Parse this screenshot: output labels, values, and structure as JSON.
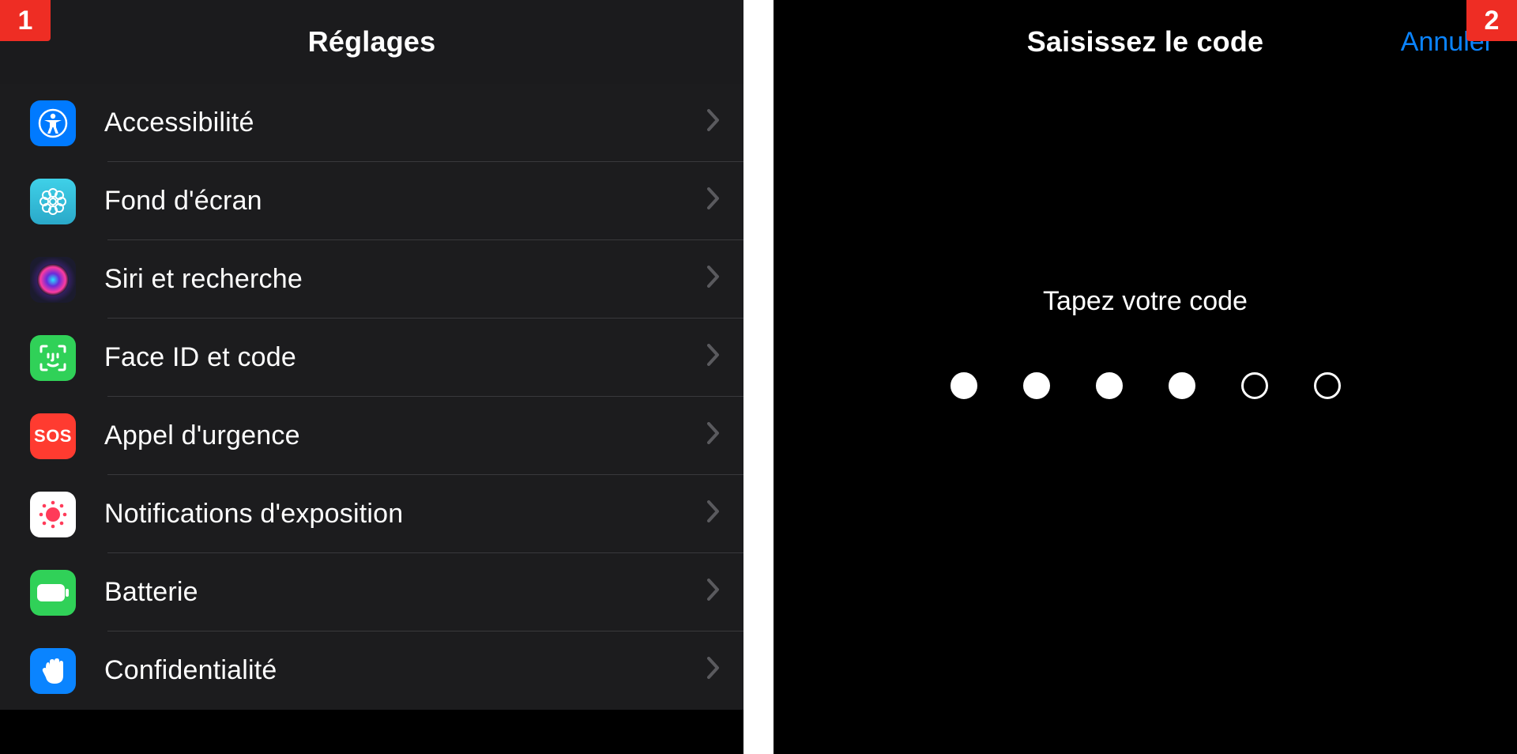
{
  "steps": {
    "left": "1",
    "right": "2"
  },
  "settings": {
    "title": "Réglages",
    "rows": [
      {
        "id": "accessibility",
        "label": "Accessibilité",
        "icon": "accessibility-icon",
        "bg": "#007aff"
      },
      {
        "id": "wallpaper",
        "label": "Fond d'écran",
        "icon": "flower-icon",
        "bg": "#34c0db"
      },
      {
        "id": "siri",
        "label": "Siri et recherche",
        "icon": "siri-icon",
        "bg": "#1b1b2e"
      },
      {
        "id": "faceid",
        "label": "Face ID et code",
        "icon": "faceid-icon",
        "bg": "#30d158"
      },
      {
        "id": "emergency",
        "label": "Appel d'urgence",
        "icon": "sos-icon",
        "bg": "#ff3b30"
      },
      {
        "id": "exposure",
        "label": "Notifications d'exposition",
        "icon": "exposure-icon",
        "bg": "#ffffff"
      },
      {
        "id": "battery",
        "label": "Batterie",
        "icon": "battery-icon",
        "bg": "#30d158"
      },
      {
        "id": "privacy",
        "label": "Confidentialité",
        "icon": "hand-icon",
        "bg": "#0a84ff"
      }
    ]
  },
  "passcode": {
    "title": "Saisissez le code",
    "cancel": "Annuler",
    "prompt": "Tapez votre code",
    "digits_total": 6,
    "digits_entered": 4
  }
}
